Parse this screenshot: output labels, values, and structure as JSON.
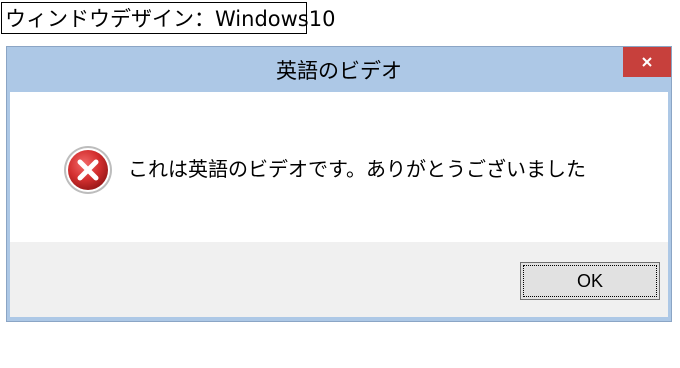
{
  "caption_label": "ウィンドウデザイン：Windows10",
  "dialog": {
    "title": "英語のビデオ",
    "close_icon": "close-icon",
    "close_glyph": "×",
    "message": "これは英語のビデオです。ありがとうございました",
    "message_icon": "error-icon",
    "ok_label": "OK"
  },
  "colors": {
    "titlebar": "#adc8e6",
    "close_button": "#c7403c",
    "error_icon": "#d32f2f",
    "button_area": "#f0f0f0"
  }
}
